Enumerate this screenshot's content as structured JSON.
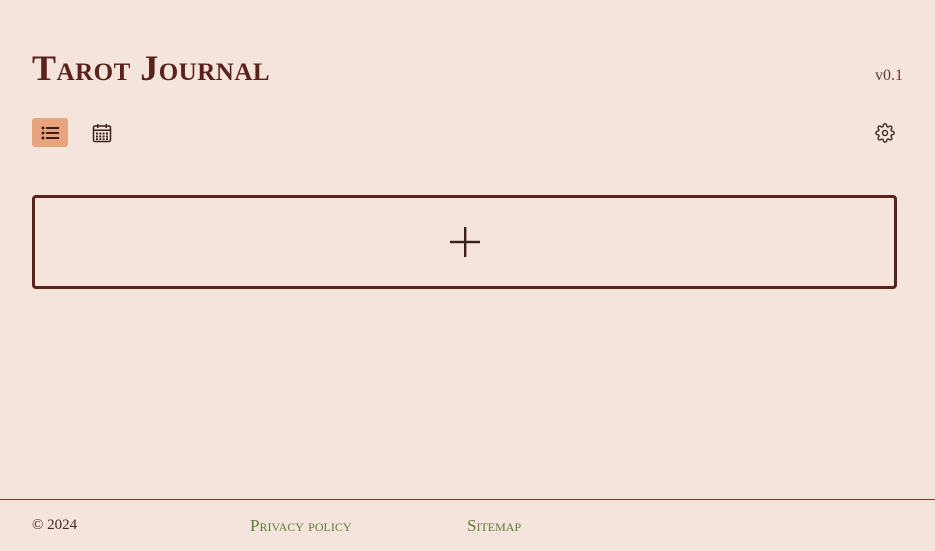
{
  "header": {
    "title": "Tarot Journal",
    "version": "v0.1"
  },
  "toolbar": {
    "views": [
      {
        "name": "list-view",
        "icon": "list-icon",
        "active": true
      },
      {
        "name": "calendar-view",
        "icon": "calendar-icon",
        "active": false
      }
    ],
    "settings_icon": "gear-icon"
  },
  "main": {
    "add_entry_icon": "plus-icon"
  },
  "footer": {
    "copyright": "© 2024",
    "links": [
      "Privacy policy",
      "Sitemap"
    ]
  },
  "colors": {
    "background": "#f5e4dc",
    "title": "#5a221c",
    "active_button": "#e8a47e",
    "link": "#5f7a3a",
    "border": "#5a221c"
  }
}
